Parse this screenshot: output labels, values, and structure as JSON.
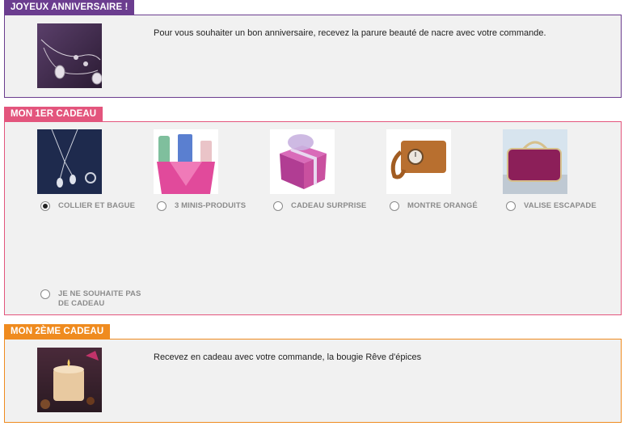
{
  "section1": {
    "title": "JOYEUX ANNIVERSAIRE !",
    "description": "Pour vous souhaiter un bon anniversaire, recevez la parure beauté de nacre avec votre commande."
  },
  "section2": {
    "title": "MON 1ER CADEAU",
    "options": [
      {
        "label": "COLLIER ET BAGUE",
        "checked": true
      },
      {
        "label": "3 MINIS-PRODUITS",
        "checked": false
      },
      {
        "label": "CADEAU SURPRISE",
        "checked": false
      },
      {
        "label": "MONTRE ORANGÉ",
        "checked": false
      },
      {
        "label": "VALISE ESCAPADE",
        "checked": false
      }
    ],
    "no_gift": {
      "line1": "JE NE SOUHAITE PAS",
      "line2": "DE CADEAU",
      "checked": false
    }
  },
  "section3": {
    "title": "MON 2ÈME CADEAU",
    "description": "Recevez en cadeau avec votre commande, la bougie Rêve d'épices"
  },
  "colors": {
    "purple": "#6b3d8f",
    "pink": "#e3557d",
    "orange": "#ef8b1f",
    "panel_bg": "#f1f1f1"
  }
}
